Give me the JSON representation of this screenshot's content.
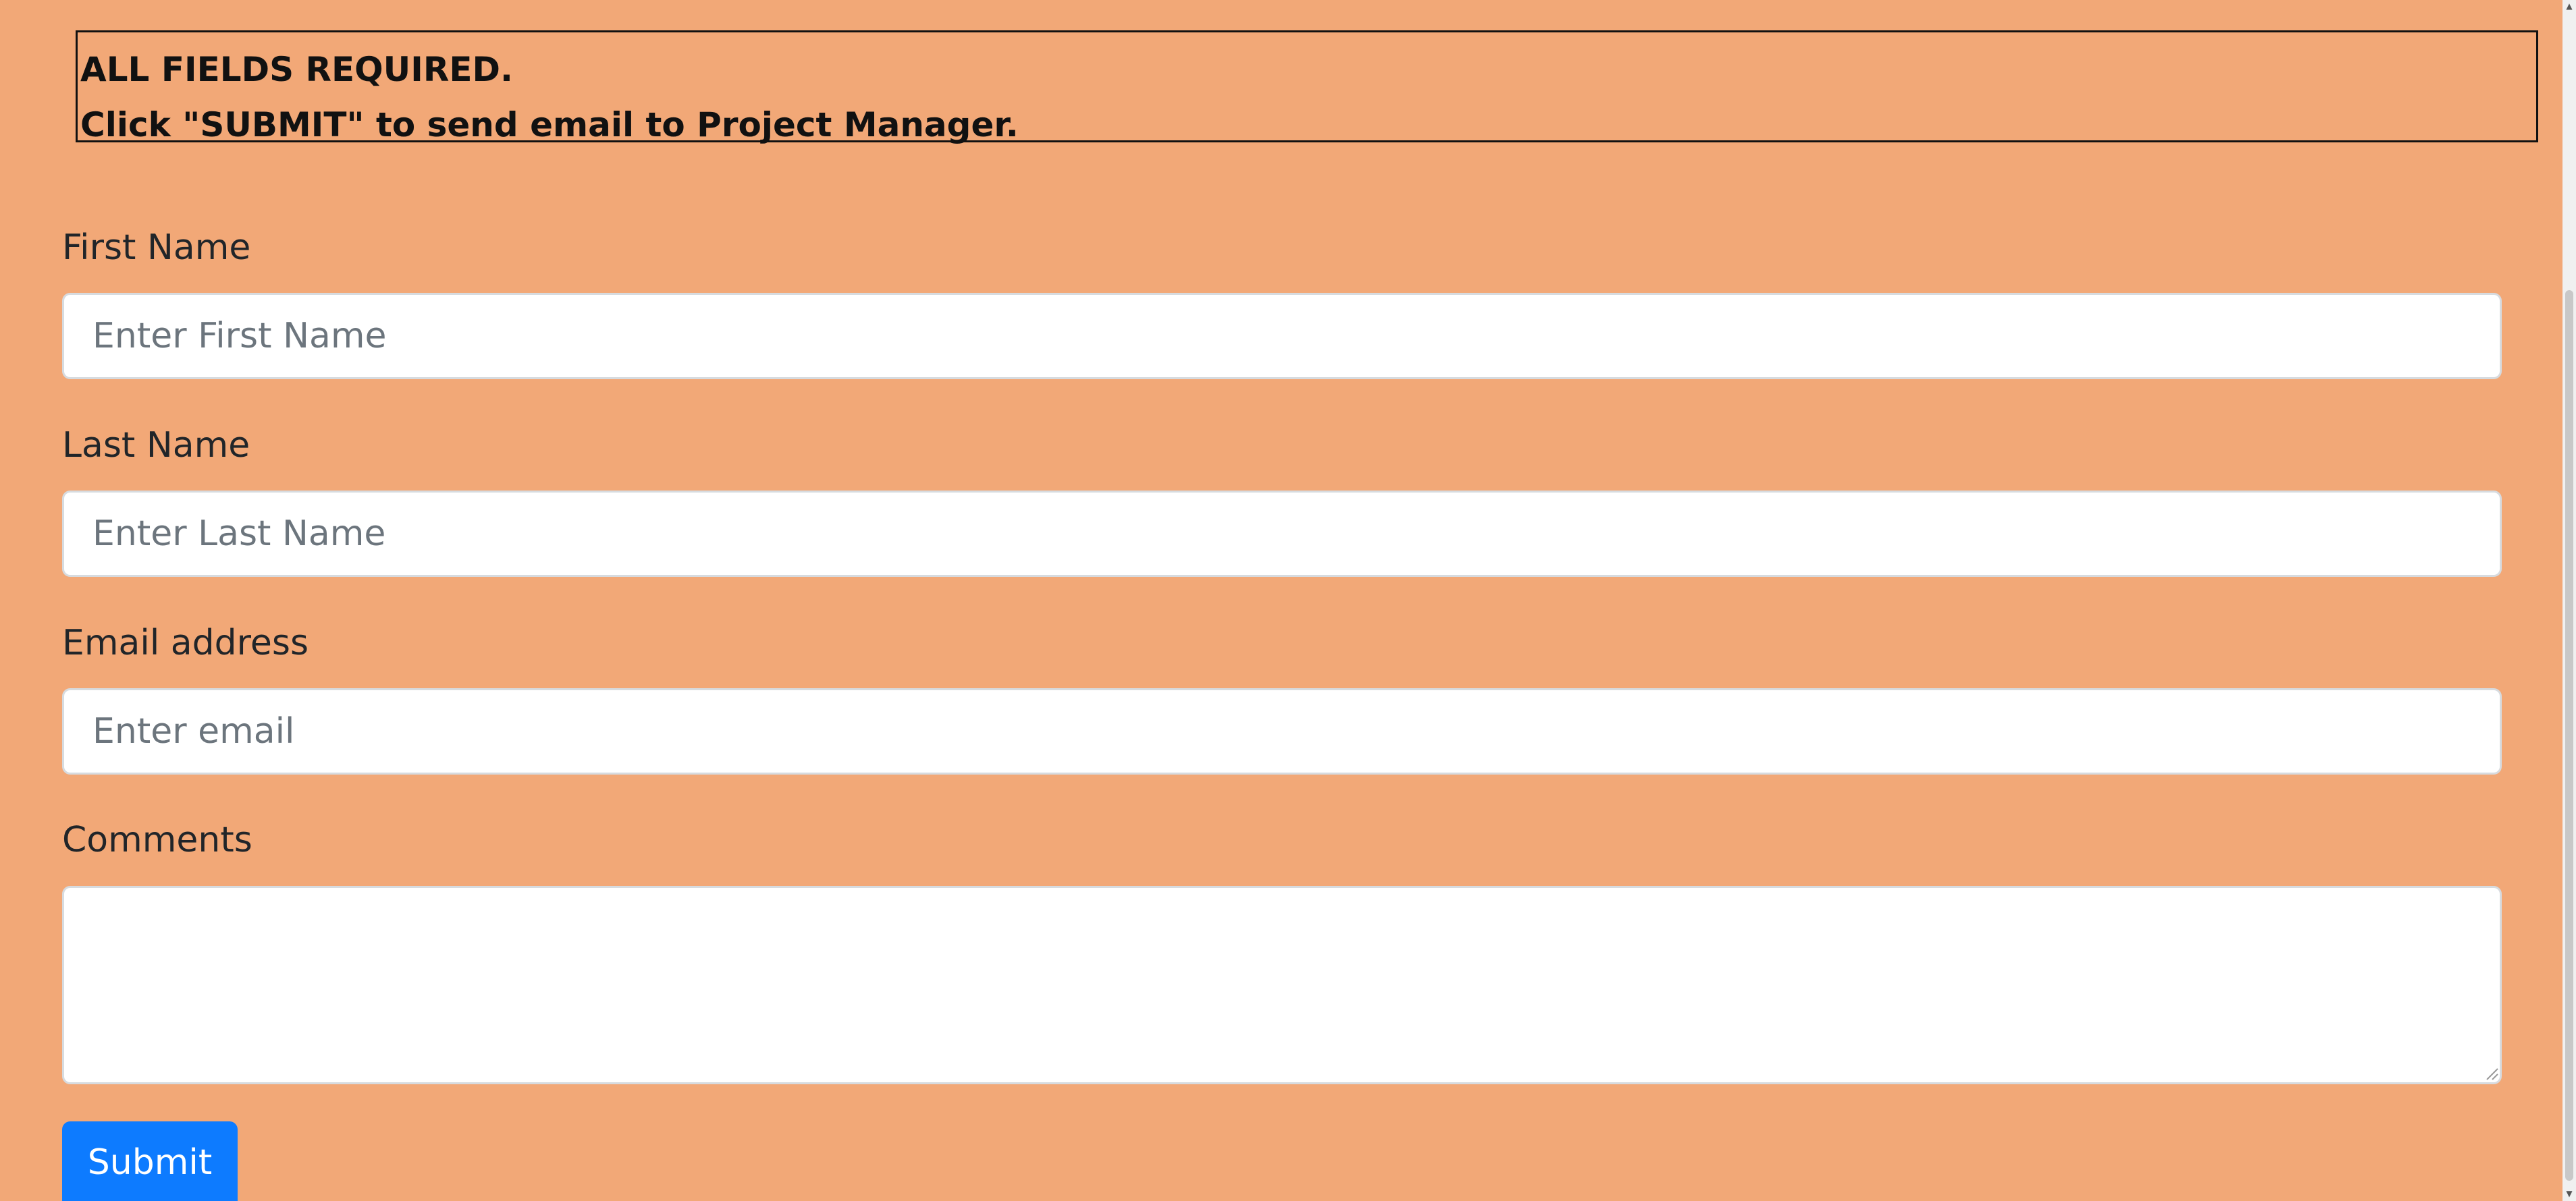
{
  "notice": {
    "line1": "ALL FIELDS REQUIRED.",
    "line2": "Click \"SUBMIT\" to send email to Project Manager."
  },
  "form": {
    "first_name": {
      "label": "First Name",
      "placeholder": "Enter First Name",
      "value": ""
    },
    "last_name": {
      "label": "Last Name",
      "placeholder": "Enter Last Name",
      "value": ""
    },
    "email": {
      "label": "Email address",
      "placeholder": "Enter email",
      "value": ""
    },
    "comments": {
      "label": "Comments",
      "value": ""
    },
    "submit_label": "Submit"
  },
  "colors": {
    "background": "#f2a877",
    "submit_button": "#0d7bff",
    "input_background": "#ffffff"
  },
  "icons": {
    "scroll_up": "scroll-up-arrow-icon",
    "scroll_down": "scroll-down-arrow-icon",
    "textarea_resize": "resize-grip-icon"
  }
}
